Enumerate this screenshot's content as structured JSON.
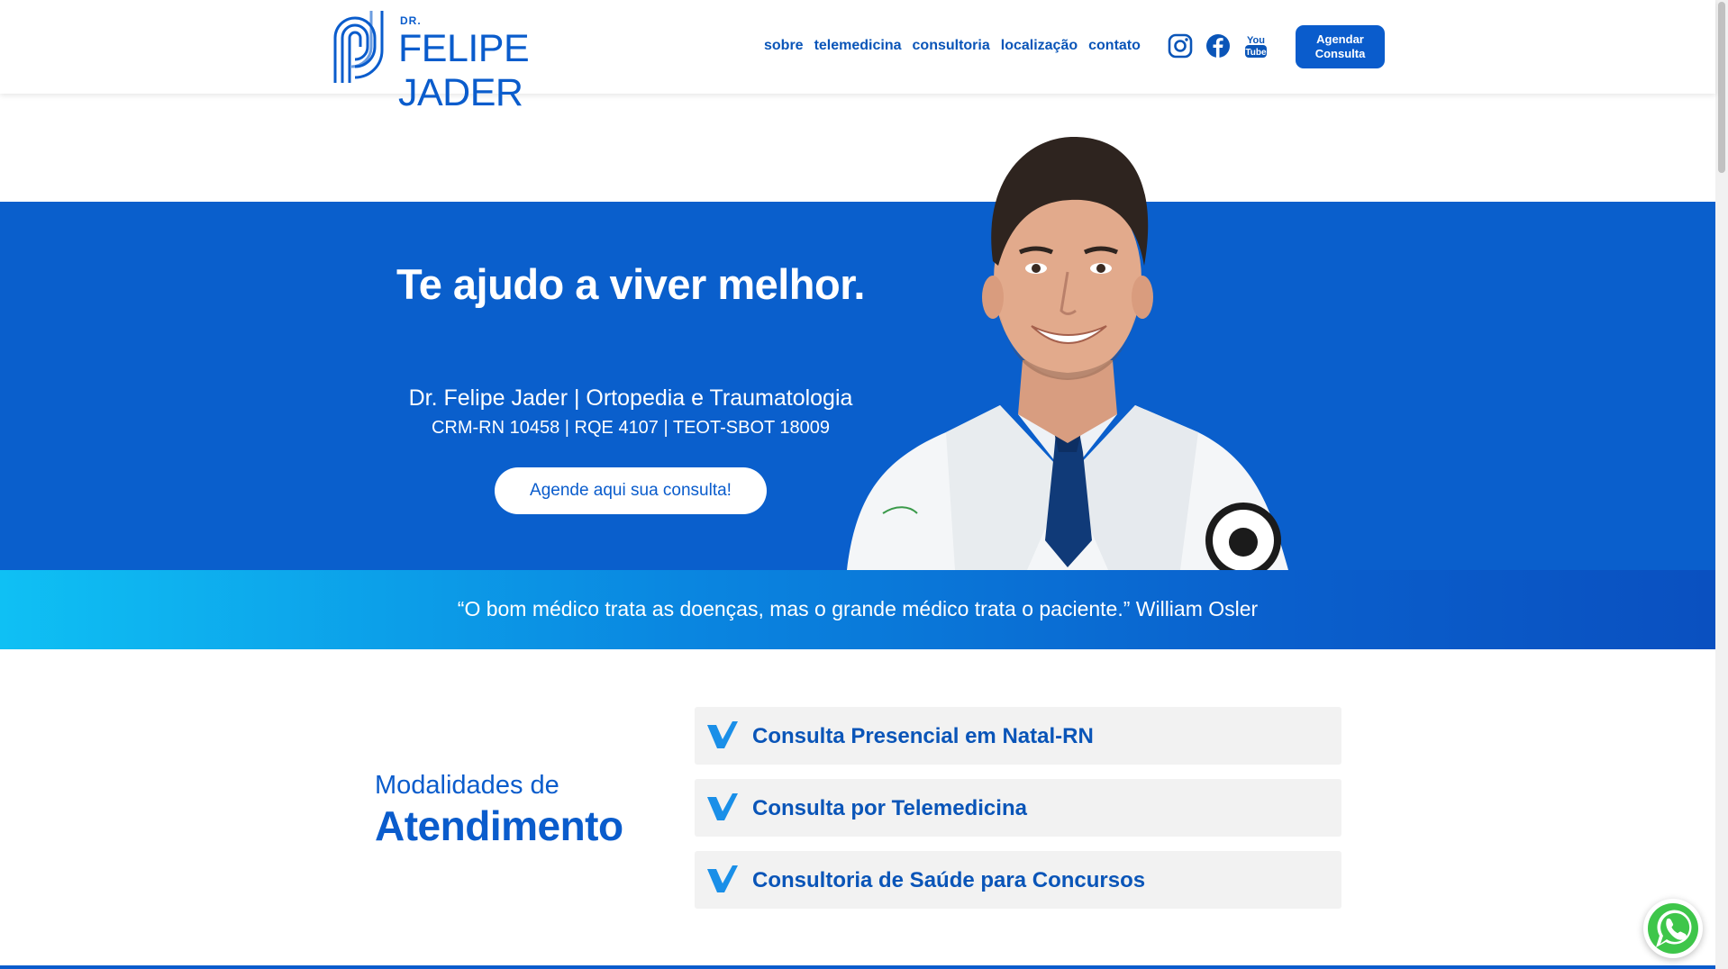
{
  "header": {
    "logo_dr": "DR.",
    "logo_name": "FELIPE JADER",
    "nav": [
      "sobre",
      "telemedicina",
      "consultoria",
      "localização",
      "contato"
    ],
    "social_icons": [
      "instagram-icon",
      "facebook-icon",
      "youtube-icon"
    ],
    "youtube_text": "You\nTube",
    "cta": "Agendar\nConsulta"
  },
  "hero": {
    "title": "Te ajudo a viver melhor.",
    "subtitle": "Dr. Felipe Jader | Ortopedia e Traumatologia",
    "credentials": "CRM-RN 10458 | RQE 4107 | TEOT-SBOT 18009",
    "button": "Agende aqui sua consulta!"
  },
  "quote": {
    "text": "“O bom médico trata as doenças, mas o grande médico trata o paciente.” William Osler"
  },
  "modalities": {
    "label_small": "Modalidades de",
    "label_big": "Atendimento",
    "items": [
      "Consulta Presencial em Natal-RN",
      "Consulta por Telemedicina",
      "Consultoria de Saúde para Concursos"
    ]
  },
  "colors": {
    "brand": "#0a5ccc",
    "accent": "#0fc0f4",
    "check": "#1a8fe8"
  }
}
